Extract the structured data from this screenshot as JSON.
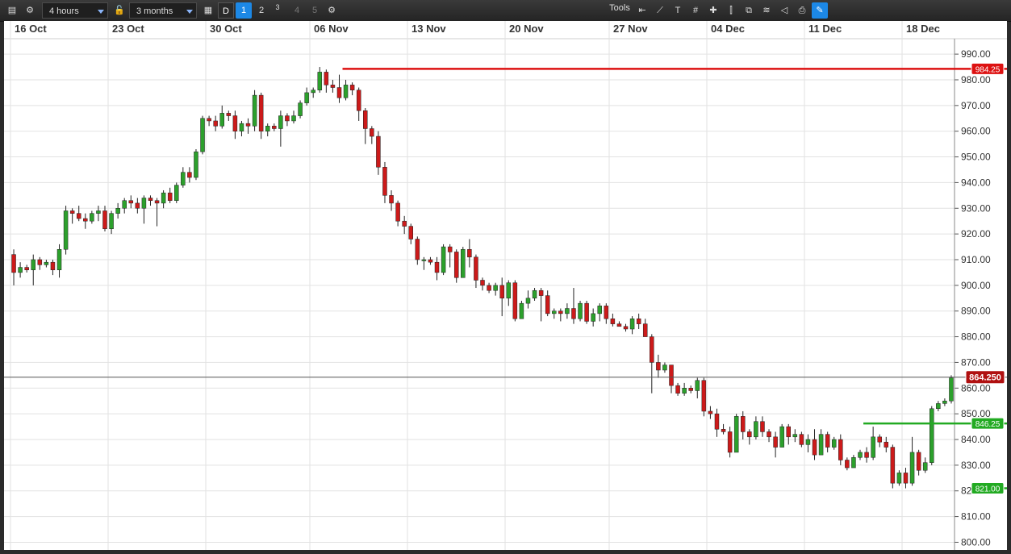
{
  "toolbar": {
    "interval": "4 hours",
    "range": "3 months",
    "period_buttons": [
      "D",
      "1",
      "2",
      "3",
      "4",
      "5"
    ],
    "tools_label": "Tools"
  },
  "chart_data": {
    "type": "candlestick",
    "x_labels": [
      "16 Oct",
      "23 Oct",
      "30 Oct",
      "06 Nov",
      "13 Nov",
      "20 Nov",
      "27 Nov",
      "04 Dec",
      "11 Dec",
      "18 Dec"
    ],
    "y_ticks": [
      "990.00",
      "980.00",
      "970.00",
      "960.00",
      "950.00",
      "940.00",
      "930.00",
      "920.00",
      "910.00",
      "900.00",
      "890.00",
      "880.00",
      "870.00",
      "860.00",
      "850.00",
      "840.00",
      "830.00",
      "82",
      "810.00",
      "800.00"
    ],
    "ylim": [
      797,
      996
    ],
    "current_price": {
      "value": 864.25,
      "label": "864.250",
      "color": "#b01010"
    },
    "horizontal_lines": [
      {
        "value": 984.25,
        "label": "984.25",
        "color": "#dd1111"
      },
      {
        "value": 846.25,
        "label": "846.25",
        "color": "#22aa22"
      },
      {
        "value": 821.0,
        "label": "821.00",
        "color": "#22aa22"
      }
    ],
    "colors": {
      "up": "#2ca02c",
      "down": "#cc1a1a",
      "wick": "#222222",
      "grid": "#e2e2e2"
    },
    "candles": [
      [
        912,
        905,
        914,
        900
      ],
      [
        905,
        907,
        909,
        903
      ],
      [
        907,
        906,
        908,
        905
      ],
      [
        906,
        910,
        912,
        900
      ],
      [
        910,
        908,
        911,
        906
      ],
      [
        908,
        909,
        910,
        907
      ],
      [
        909,
        906,
        910,
        904
      ],
      [
        906,
        914,
        916,
        903
      ],
      [
        914,
        929,
        931,
        912
      ],
      [
        929,
        928,
        930,
        924
      ],
      [
        928,
        926,
        931,
        925
      ],
      [
        926,
        925,
        928,
        922
      ],
      [
        925,
        928,
        929,
        924
      ],
      [
        928,
        929,
        931,
        925
      ],
      [
        929,
        922,
        931,
        921
      ],
      [
        922,
        928,
        929,
        920
      ],
      [
        928,
        930,
        932,
        926
      ],
      [
        930,
        933,
        934,
        928
      ],
      [
        933,
        932,
        935,
        930
      ],
      [
        932,
        930,
        934,
        928
      ],
      [
        930,
        934,
        935,
        924
      ],
      [
        934,
        933,
        935,
        931
      ],
      [
        933,
        932,
        934,
        923
      ],
      [
        932,
        936,
        937,
        930
      ],
      [
        936,
        933,
        938,
        932
      ],
      [
        933,
        939,
        940,
        932
      ],
      [
        939,
        944,
        946,
        938
      ],
      [
        944,
        942,
        946,
        940
      ],
      [
        942,
        952,
        953,
        941
      ],
      [
        952,
        965,
        966,
        951
      ],
      [
        965,
        964,
        966,
        962
      ],
      [
        964,
        962,
        966,
        960
      ],
      [
        962,
        967,
        970,
        961
      ],
      [
        967,
        966,
        968,
        964
      ],
      [
        966,
        960,
        968,
        957
      ],
      [
        960,
        963,
        964,
        958
      ],
      [
        963,
        962,
        965,
        959
      ],
      [
        962,
        974,
        976,
        960
      ],
      [
        974,
        960,
        975,
        957
      ],
      [
        960,
        962,
        963,
        958
      ],
      [
        962,
        961,
        963,
        960
      ],
      [
        961,
        966,
        968,
        954
      ],
      [
        966,
        964,
        967,
        962
      ],
      [
        964,
        966,
        968,
        963
      ],
      [
        966,
        971,
        972,
        965
      ],
      [
        971,
        975,
        977,
        970
      ],
      [
        975,
        976,
        977,
        973
      ],
      [
        976,
        983,
        985,
        975
      ],
      [
        983,
        978,
        984,
        975
      ],
      [
        978,
        977,
        980,
        975
      ],
      [
        977,
        973,
        982,
        971
      ],
      [
        973,
        978,
        980,
        972
      ],
      [
        978,
        976,
        979,
        974
      ],
      [
        976,
        968,
        977,
        964
      ],
      [
        968,
        961,
        969,
        955
      ],
      [
        961,
        958,
        962,
        955
      ],
      [
        958,
        946,
        960,
        943
      ],
      [
        946,
        935,
        948,
        932
      ],
      [
        935,
        932,
        937,
        929
      ],
      [
        932,
        925,
        933,
        923
      ],
      [
        925,
        923,
        927,
        920
      ],
      [
        923,
        918,
        924,
        916
      ],
      [
        918,
        910,
        919,
        908
      ],
      [
        910,
        910,
        911,
        906
      ],
      [
        910,
        909,
        911,
        908
      ],
      [
        909,
        905,
        911,
        902
      ],
      [
        905,
        915,
        916,
        904
      ],
      [
        915,
        913,
        916,
        907
      ],
      [
        913,
        903,
        914,
        901
      ],
      [
        903,
        914,
        915,
        906
      ],
      [
        914,
        911,
        918,
        907
      ],
      [
        911,
        902,
        912,
        899
      ],
      [
        902,
        900,
        903,
        898
      ],
      [
        900,
        898,
        901,
        897
      ],
      [
        898,
        900,
        901,
        896
      ],
      [
        900,
        895,
        903,
        888
      ],
      [
        895,
        901,
        902,
        892
      ],
      [
        901,
        887,
        902,
        886
      ],
      [
        887,
        893,
        894,
        888
      ],
      [
        893,
        895,
        898,
        891
      ],
      [
        895,
        898,
        899,
        894
      ],
      [
        898,
        896,
        899,
        886
      ],
      [
        896,
        889,
        898,
        888
      ],
      [
        889,
        890,
        891,
        887
      ],
      [
        890,
        889,
        891,
        886
      ],
      [
        889,
        891,
        893,
        887
      ],
      [
        891,
        887,
        899,
        885
      ],
      [
        887,
        893,
        894,
        886
      ],
      [
        893,
        886,
        894,
        885
      ],
      [
        886,
        889,
        891,
        884
      ],
      [
        889,
        892,
        893,
        886
      ],
      [
        892,
        887,
        893,
        885
      ],
      [
        887,
        885,
        889,
        884
      ],
      [
        885,
        884,
        886,
        884
      ],
      [
        884,
        883,
        885,
        882
      ],
      [
        883,
        887,
        888,
        881
      ],
      [
        887,
        885,
        889,
        883
      ],
      [
        885,
        880,
        887,
        882
      ],
      [
        880,
        870,
        881,
        858
      ],
      [
        870,
        867,
        873,
        864
      ],
      [
        867,
        869,
        870,
        866
      ],
      [
        869,
        861,
        869,
        858
      ],
      [
        861,
        858,
        862,
        857
      ],
      [
        858,
        860,
        862,
        857
      ],
      [
        860,
        859,
        861,
        858
      ],
      [
        859,
        863,
        864,
        856
      ],
      [
        863,
        851,
        864,
        849
      ],
      [
        851,
        850,
        853,
        848
      ],
      [
        850,
        844,
        852,
        841
      ],
      [
        844,
        843,
        846,
        842
      ],
      [
        843,
        835,
        845,
        833
      ],
      [
        835,
        849,
        850,
        840
      ],
      [
        849,
        843,
        851,
        840
      ],
      [
        843,
        841,
        844,
        838
      ],
      [
        841,
        847,
        849,
        840
      ],
      [
        847,
        843,
        849,
        841
      ],
      [
        843,
        841,
        844,
        839
      ],
      [
        841,
        837,
        843,
        833
      ],
      [
        837,
        845,
        846,
        839
      ],
      [
        845,
        841,
        846,
        838
      ],
      [
        841,
        842,
        844,
        839
      ],
      [
        842,
        838,
        843,
        837
      ],
      [
        838,
        840,
        842,
        835
      ],
      [
        840,
        834,
        844,
        832
      ],
      [
        834,
        842,
        844,
        836
      ],
      [
        842,
        837,
        843,
        835
      ],
      [
        837,
        840,
        841,
        836
      ],
      [
        840,
        832,
        842,
        830
      ],
      [
        832,
        829,
        833,
        828
      ],
      [
        829,
        833,
        834,
        829
      ],
      [
        833,
        835,
        836,
        832
      ],
      [
        835,
        833,
        837,
        831
      ],
      [
        833,
        841,
        845,
        832
      ],
      [
        841,
        839,
        842,
        837
      ],
      [
        839,
        837,
        841,
        835
      ],
      [
        837,
        823,
        838,
        821
      ],
      [
        823,
        827,
        828,
        822
      ],
      [
        827,
        823,
        829,
        821
      ],
      [
        823,
        835,
        841,
        822
      ],
      [
        835,
        828,
        836,
        826
      ],
      [
        828,
        831,
        833,
        827
      ],
      [
        831,
        852,
        853,
        830
      ],
      [
        852,
        854,
        855,
        851
      ],
      [
        854,
        855,
        856,
        853
      ],
      [
        855,
        864,
        865,
        854
      ]
    ]
  }
}
